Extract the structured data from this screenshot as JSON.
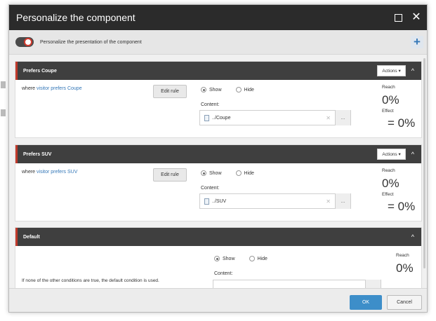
{
  "dialog": {
    "title": "Personalize the component"
  },
  "subbar": {
    "label": "Personalize the presentation of the component"
  },
  "rules": [
    {
      "name": "Prefers Coupe",
      "actions_label": "Actions",
      "condition_prefix": "where ",
      "condition_link": "visitor prefers Coupe",
      "edit_label": "Edit rule",
      "show_label": "Show",
      "hide_label": "Hide",
      "content_label": "Content:",
      "content_value": "../Coupe",
      "browse_label": "...",
      "reach_label": "Reach",
      "reach_value": "0%",
      "effect_label": "Effect",
      "effect_value": "= 0%"
    },
    {
      "name": "Prefers SUV",
      "actions_label": "Actions",
      "condition_prefix": "where ",
      "condition_link": "visitor prefers SUV",
      "edit_label": "Edit rule",
      "show_label": "Show",
      "hide_label": "Hide",
      "content_label": "Content:",
      "content_value": "../SUV",
      "browse_label": "...",
      "reach_label": "Reach",
      "reach_value": "0%",
      "effect_label": "Effect",
      "effect_value": "= 0%"
    }
  ],
  "default_rule": {
    "name": "Default",
    "description": "If none of the other conditions are true, the default condition is used.",
    "show_label": "Show",
    "hide_label": "Hide",
    "content_label": "Content:",
    "reach_label": "Reach",
    "reach_value": "0%"
  },
  "footer": {
    "ok_label": "OK",
    "cancel_label": "Cancel"
  },
  "colors": {
    "title_bar": "#2b2b2b",
    "rule_header": "#3f3f3f",
    "accent_red": "#c0392b",
    "link_blue": "#3578b8",
    "ok_blue": "#3d8ec9"
  }
}
